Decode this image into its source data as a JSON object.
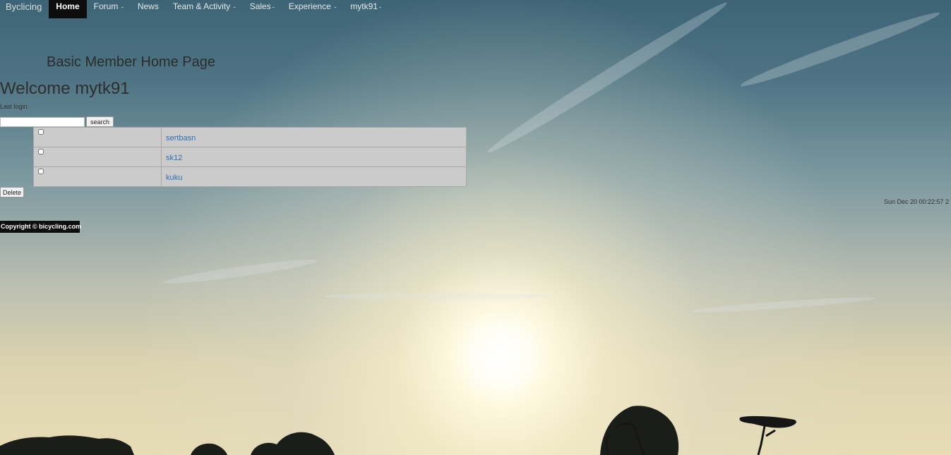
{
  "nav": {
    "brand": "Byclicing",
    "items": [
      {
        "label": "Home",
        "caret": ""
      },
      {
        "label": "Forum",
        "caret": " -"
      },
      {
        "label": "News",
        "caret": ""
      },
      {
        "label": "Team & Activity",
        "caret": " -"
      },
      {
        "label": "Sales",
        "caret": "-"
      },
      {
        "label": "Experience",
        "caret": " -"
      },
      {
        "label": "mytk91",
        "caret": "-"
      }
    ],
    "active": "Home"
  },
  "page_title": "Basic Member Home Page",
  "welcome": "Welcome mytk91",
  "last_login_label": "Last login:",
  "search": {
    "value": "",
    "button_label": "search"
  },
  "members": [
    {
      "name": "sertbasn",
      "checked": false
    },
    {
      "name": "sk12",
      "checked": false
    },
    {
      "name": "kuku",
      "checked": false
    }
  ],
  "delete_label": "Delete",
  "timestamp": "Sun Dec 20 00:22:57 2",
  "copyright": "Copyright © bicycling.com",
  "colors": {
    "nav_active_bg": "#0d0d0d",
    "link": "#2c6fb7",
    "table_bg": "#cbcbcb"
  }
}
